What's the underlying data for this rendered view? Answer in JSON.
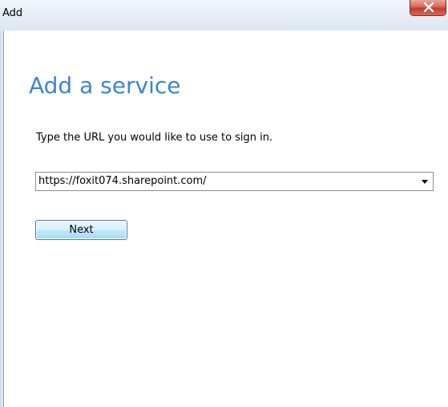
{
  "window": {
    "title": "Add",
    "close_icon": "close-x-icon"
  },
  "main": {
    "heading": "Add a service",
    "prompt": "Type the URL you would like to use to sign in.",
    "url_value": "https://foxit074.sharepoint.com/",
    "dropdown_icon": "chevron-down-icon",
    "next_label": "Next"
  },
  "colors": {
    "heading": "#3a86d6",
    "close_button": "#c4392c",
    "next_button_border": "#3c7fb1"
  }
}
